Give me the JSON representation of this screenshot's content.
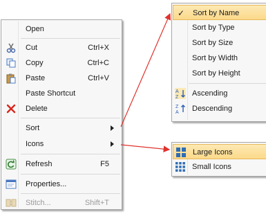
{
  "context_menu": {
    "open": "Open",
    "cut": {
      "label": "Cut",
      "shortcut": "Ctrl+X"
    },
    "copy": {
      "label": "Copy",
      "shortcut": "Ctrl+C"
    },
    "paste": {
      "label": "Paste",
      "shortcut": "Ctrl+V"
    },
    "paste_shortcut": "Paste Shortcut",
    "delete": "Delete",
    "sort": "Sort",
    "icons": "Icons",
    "refresh": {
      "label": "Refresh",
      "shortcut": "F5"
    },
    "properties": "Properties...",
    "stitch": {
      "label": "Stitch...",
      "shortcut": "Shift+T"
    }
  },
  "sort_submenu": {
    "check_mark": "✓",
    "items": [
      "Sort by Name",
      "Sort by Type",
      "Sort by Size",
      "Sort by Width",
      "Sort by Height"
    ],
    "ascending": "Ascending",
    "descending": "Descending"
  },
  "icons_submenu": {
    "large": "Large Icons",
    "small": "Small Icons"
  },
  "colors": {
    "highlight": "#fbd98a",
    "connector": "#e0332d"
  }
}
